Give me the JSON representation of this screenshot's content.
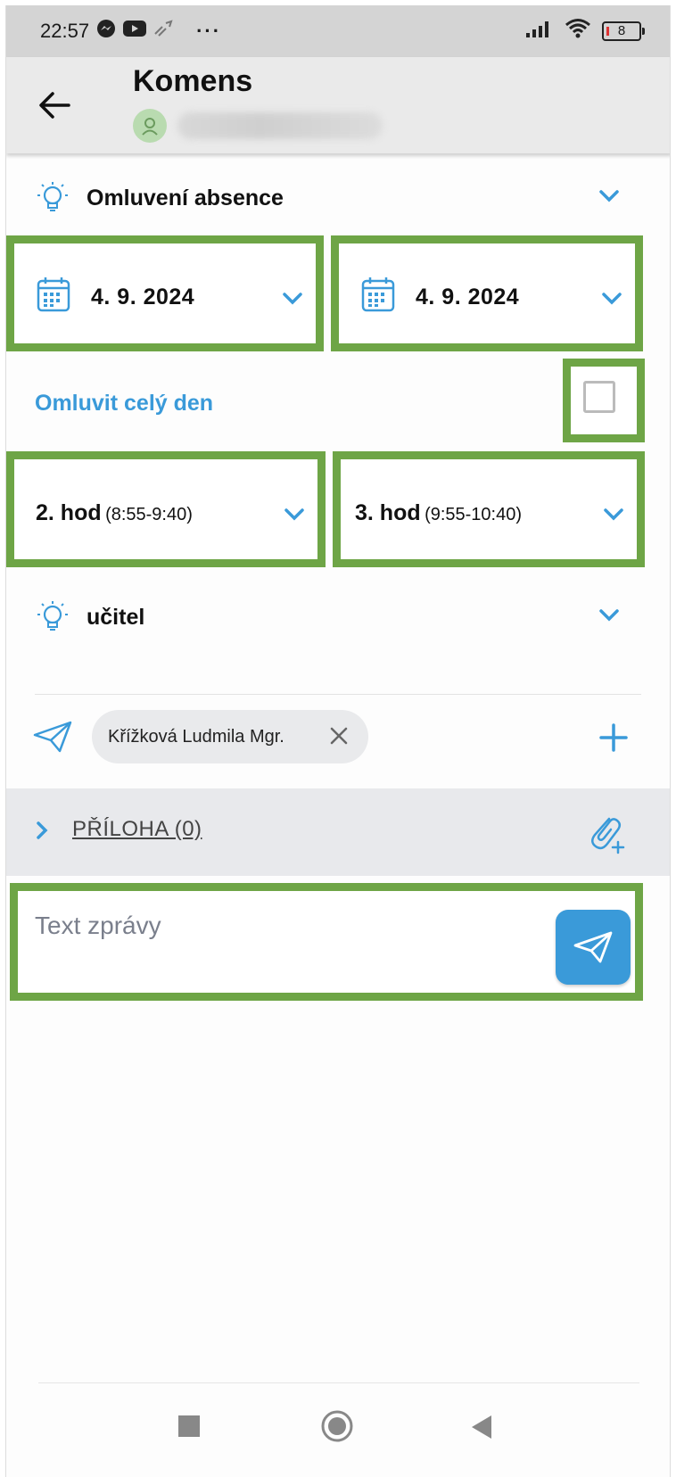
{
  "status_bar": {
    "time": "22:57",
    "dots": "···",
    "battery": "8"
  },
  "app_bar": {
    "title": "Komens"
  },
  "form": {
    "message_type": "Omluvení absence",
    "date_from": "4. 9. 2024",
    "date_to": "4. 9. 2024",
    "whole_day_label": "Omluvit celý den",
    "whole_day_checked": false,
    "hour_from": {
      "main": "2. hod",
      "sub": "(8:55-9:40)"
    },
    "hour_to": {
      "main": "3. hod",
      "sub": "(9:55-10:40)"
    },
    "recipient_type": "učitel",
    "recipient_chip": "Křížková Ludmila Mgr.",
    "attachment_label": "PŘÍLOHA (0)",
    "message_placeholder": "Text zprávy"
  },
  "colors": {
    "accent": "#3a9ad9",
    "highlight": "#6ea546",
    "appbar": "#eaeaea",
    "statusbar": "#d4d4d4"
  },
  "icons": {
    "back": "arrow-left-icon",
    "type": "lightbulb-icon",
    "date": "calendar-icon",
    "recipient_type": "lightbulb-icon",
    "recipients": "paper-plane-icon",
    "add": "plus-icon",
    "attach": "paperclip-plus-icon",
    "send": "paper-plane-icon"
  }
}
